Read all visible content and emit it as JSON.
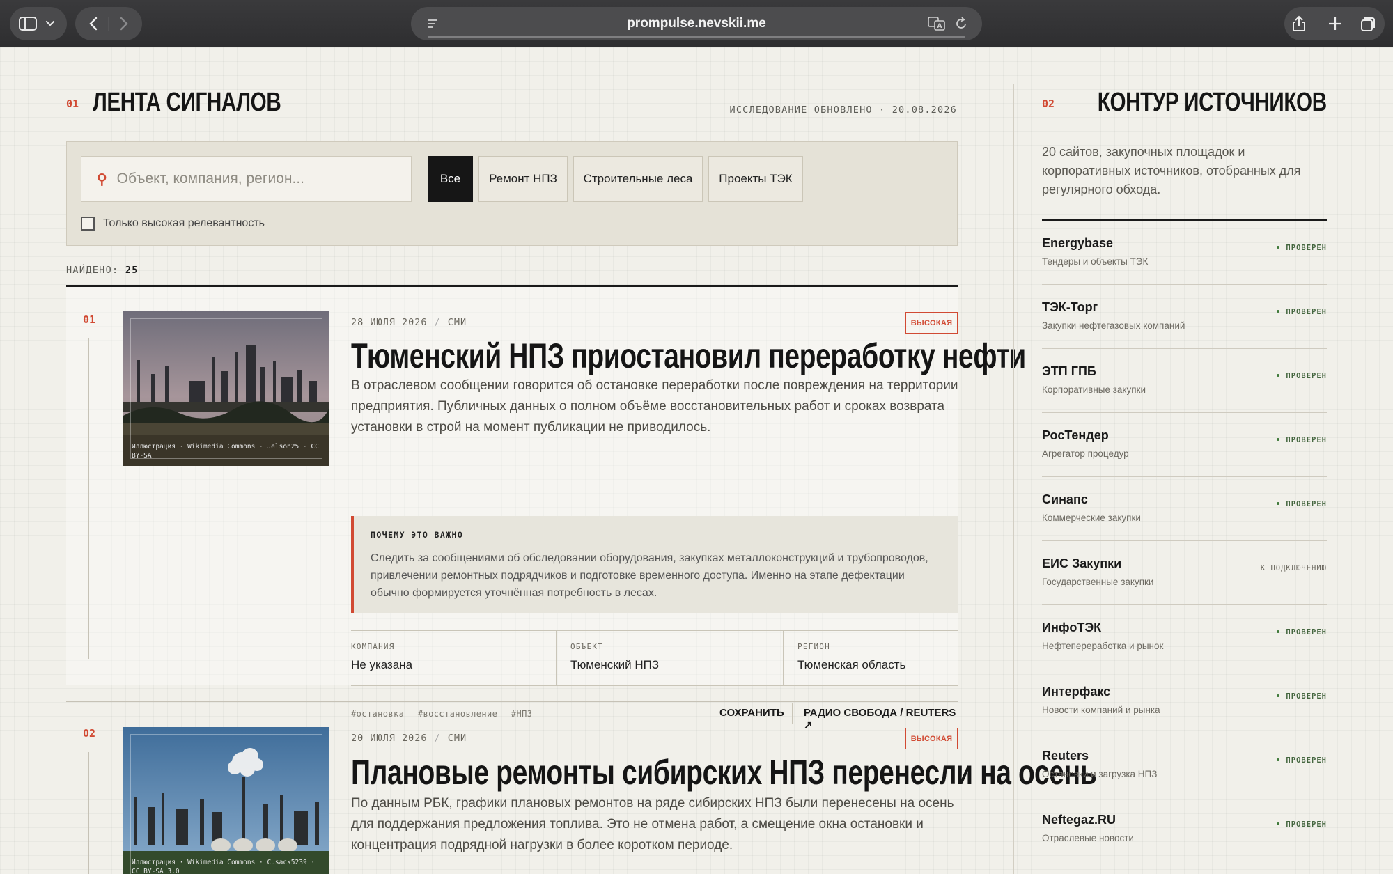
{
  "browser": {
    "url": "prompulse.nevskii.me"
  },
  "feed": {
    "section_num": "01",
    "section_title": "ЛЕНТА СИГНАЛОВ",
    "updated": "ИССЛЕДОВАНИЕ ОБНОВЛЕНО · 20.08.2026",
    "search_placeholder": "Объект, компания, регион...",
    "filters": [
      "Все",
      "Ремонт НПЗ",
      "Строительные леса",
      "Проекты ТЭК"
    ],
    "active_filter": "Все",
    "checkbox_label": "Только высокая релевантность",
    "found_label": "НАЙДЕНО:",
    "found_count": "25",
    "cards": [
      {
        "index": "01",
        "date": "28 ИЮЛЯ 2026",
        "type": "СМИ",
        "badge": "ВЫСОКАЯ",
        "title": "Тюменский НПЗ приостановил переработку нефти",
        "lead": "В отраслевом сообщении говорится об остановке переработки после повреждения на территории предприятия. Публичных данных о полном объёме восстановительных работ и сроках возврата установки в строй на момент публикации не приводилось.",
        "image_caption": "Иллюстрация · Wikimedia Commons · Jelson25 · CC BY-SA",
        "why_title": "ПОЧЕМУ ЭТО ВАЖНО",
        "why_text": "Следить за сообщениями об обследовании оборудования, закупках металлоконструкций и трубопроводов, привлечении ремонтных подрядчиков и подготовке временного доступа. Именно на этапе дефектации обычно формируется уточнённая потребность в лесах.",
        "facts": [
          {
            "key": "КОМПАНИЯ",
            "value": "Не указана"
          },
          {
            "key": "ОБЪЕКТ",
            "value": "Тюменский НПЗ"
          },
          {
            "key": "РЕГИОН",
            "value": "Тюменская область"
          }
        ],
        "tags": [
          "#остановка",
          "#восстановление",
          "#НПЗ"
        ],
        "save_label": "СОХРАНИТЬ",
        "source_label": "РАДИО СВОБОДА / REUTERS ↗"
      },
      {
        "index": "02",
        "date": "20 ИЮЛЯ 2026",
        "type": "СМИ",
        "badge": "ВЫСОКАЯ",
        "title": "Плановые ремонты сибирских НПЗ перенесли на осень",
        "lead": "По данным РБК, графики плановых ремонтов на ряде сибирских НПЗ были перенесены на осень для поддержания предложения топлива. Это не отмена работ, а смещение окна остановки и концентрация подрядной нагрузки в более коротком периоде.",
        "image_caption": "Иллюстрация · Wikimedia Commons · Cusack5239 · CC BY-SA 3.0"
      }
    ]
  },
  "sources": {
    "section_num": "02",
    "section_title": "КОНТУР ИСТОЧНИКОВ",
    "description": "20 сайтов, закупочных площадок и корпоративных источников, отобранных для регулярного обхода.",
    "items": [
      {
        "name": "Energybase",
        "sub": "Тендеры и объекты ТЭК",
        "status": "ПРОВЕРЕН"
      },
      {
        "name": "ТЭК-Торг",
        "sub": "Закупки нефтегазовых компаний",
        "status": "ПРОВЕРЕН"
      },
      {
        "name": "ЭТП ГПБ",
        "sub": "Корпоративные закупки",
        "status": "ПРОВЕРЕН"
      },
      {
        "name": "РосТендер",
        "sub": "Агрегатор процедур",
        "status": "ПРОВЕРЕН"
      },
      {
        "name": "Синапс",
        "sub": "Коммерческие закупки",
        "status": "ПРОВЕРЕН"
      },
      {
        "name": "ЕИС Закупки",
        "sub": "Государственные закупки",
        "status": "К ПОДКЛЮЧЕНИЮ"
      },
      {
        "name": "ИнфоТЭК",
        "sub": "Нефтепереработка и рынок",
        "status": "ПРОВЕРЕН"
      },
      {
        "name": "Интерфакс",
        "sub": "Новости компаний и рынка",
        "status": "ПРОВЕРЕН"
      },
      {
        "name": "Reuters",
        "sub": "Остановки и загрузка НПЗ",
        "status": "ПРОВЕРЕН"
      },
      {
        "name": "Neftegaz.RU",
        "sub": "Отраслевые новости",
        "status": "ПРОВЕРЕН"
      }
    ]
  },
  "colors": {
    "accent": "#d14a33",
    "verified": "#3f7a3a",
    "background": "#f1f0ea"
  }
}
